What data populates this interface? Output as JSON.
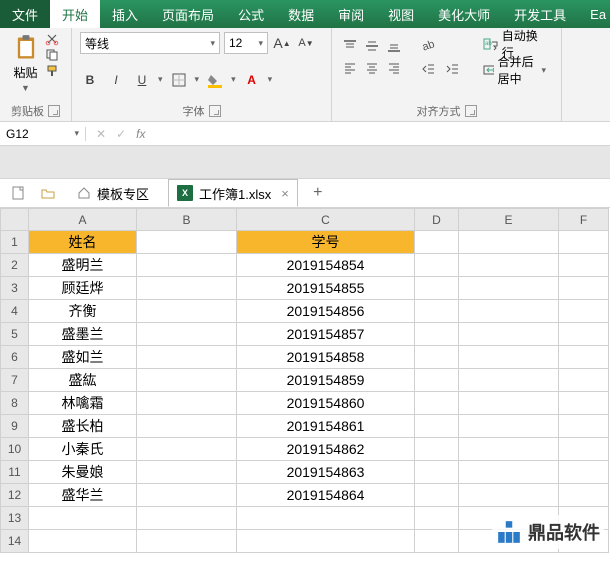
{
  "tabs": [
    "文件",
    "开始",
    "插入",
    "页面布局",
    "公式",
    "数据",
    "审阅",
    "视图",
    "美化大师",
    "开发工具",
    "Ea"
  ],
  "active_tab": 1,
  "ribbon": {
    "paste": "粘贴",
    "clipboard": "剪贴板",
    "font_group": "字体",
    "align_group": "对齐方式",
    "font_name": "等线",
    "font_size": "12",
    "wrap": "自动换行",
    "merge": "合并后居中",
    "bold": "B",
    "italic": "I",
    "underline": "U",
    "aa_big": "A",
    "aa_small": "A"
  },
  "namebox": "G12",
  "fx": "fx",
  "doctabs": {
    "templates": "模板专区",
    "file": "工作簿1.xlsx",
    "close": "×",
    "add": "+"
  },
  "columns": [
    "A",
    "B",
    "C",
    "D",
    "E",
    "F"
  ],
  "headers": {
    "A": "姓名",
    "C": "学号"
  },
  "rows": [
    {
      "n": "盛明兰",
      "id": "2019154854"
    },
    {
      "n": "顾廷烨",
      "id": "2019154855"
    },
    {
      "n": "齐衡",
      "id": "2019154856"
    },
    {
      "n": "盛墨兰",
      "id": "2019154857"
    },
    {
      "n": "盛如兰",
      "id": "2019154858"
    },
    {
      "n": "盛紘",
      "id": "2019154859"
    },
    {
      "n": "林噙霜",
      "id": "2019154860"
    },
    {
      "n": "盛长柏",
      "id": "2019154861"
    },
    {
      "n": "小秦氏",
      "id": "2019154862"
    },
    {
      "n": "朱曼娘",
      "id": "2019154863"
    },
    {
      "n": "盛华兰",
      "id": "2019154864"
    }
  ],
  "extra_rows": 2,
  "logo": "鼎品软件"
}
